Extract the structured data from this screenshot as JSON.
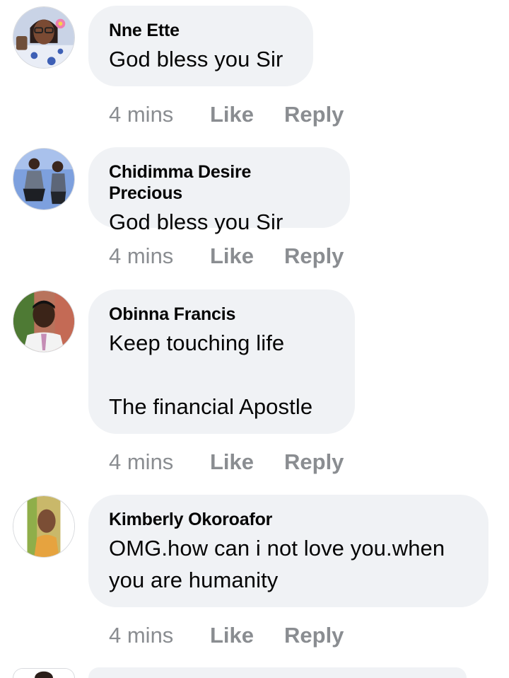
{
  "comments": [
    {
      "author": "Nne Ette",
      "lines": [
        "God bless you Sir"
      ],
      "time": "4 mins",
      "like_label": "Like",
      "reply_label": "Reply"
    },
    {
      "author": "Chidimma Desire Precious",
      "lines": [
        "God bless you Sir"
      ],
      "time": "4 mins",
      "like_label": "Like",
      "reply_label": "Reply"
    },
    {
      "author": "Obinna Francis",
      "lines": [
        "Keep touching life",
        "",
        "The financial Apostle"
      ],
      "time": "4 mins",
      "like_label": "Like",
      "reply_label": "Reply"
    },
    {
      "author": "Kimberly Okoroafor",
      "lines": [
        "OMG.how can i not love you.when",
        "you are humanity"
      ],
      "time": "4 mins",
      "like_label": "Like",
      "reply_label": "Reply"
    }
  ],
  "colors": {
    "bubble": "#f0f2f5",
    "meta_text": "#8a8d91",
    "primary_text": "#050505"
  }
}
